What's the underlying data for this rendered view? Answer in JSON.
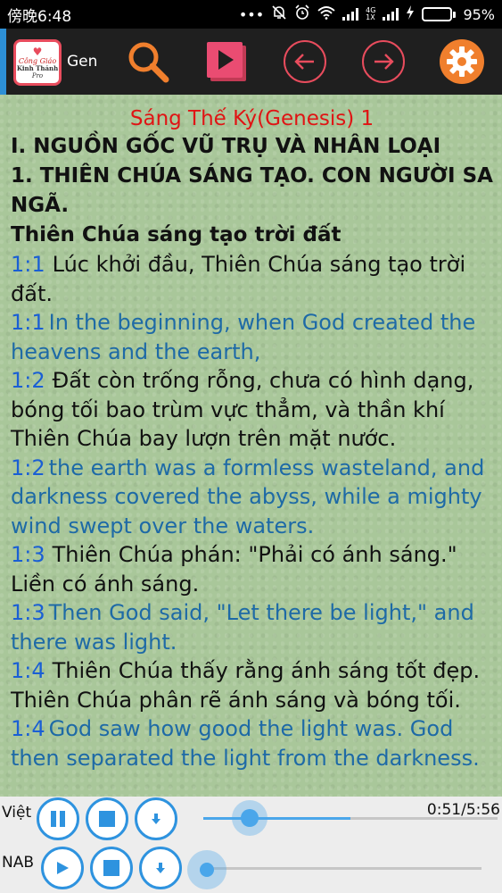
{
  "status_bar": {
    "time": "傍晚6:48",
    "dots": "•••",
    "network_4g": "4G",
    "network_1x": "1X",
    "battery_pct": "95%",
    "battery_level": 0.95
  },
  "toolbar": {
    "logo_lines": [
      "Công Giáo",
      "Kinh Thánh",
      "Pro"
    ],
    "book_label": "Gen",
    "colors": {
      "bar": "#1f1f1f",
      "accent": "#2d8fd5",
      "pink": "#e84c5d",
      "orange": "#f07f2d"
    }
  },
  "reader": {
    "chapter_title": "Sáng Thế Ký(Genesis) 1",
    "headings": [
      "I. NGUỒN GỐC VŨ TRỤ VÀ NHÂN LOẠI",
      "1. THIÊN CHÚA SÁNG TẠO. CON NGƯỜI SA NGÃ.",
      "Thiên Chúa sáng tạo trời đất"
    ],
    "verses": [
      {
        "ref": "1:1",
        "lang": "vi",
        "text": "Lúc khởi đầu, Thiên Chúa sáng tạo trời đất."
      },
      {
        "ref": "1:1",
        "lang": "en",
        "text": "In the beginning, when God created the heavens and the earth,"
      },
      {
        "ref": "1:2",
        "lang": "vi",
        "text": "Đất còn trống rỗng, chưa có hình dạng, bóng tối bao trùm vực thẳm, và thần khí Thiên Chúa bay lượn trên mặt nước."
      },
      {
        "ref": "1:2",
        "lang": "en",
        "text": "the earth was a formless wasteland, and darkness covered the abyss, while a mighty wind swept over the waters."
      },
      {
        "ref": "1:3",
        "lang": "vi",
        "text": "Thiên Chúa phán: \"Phải có ánh sáng.\" Liền có ánh sáng."
      },
      {
        "ref": "1:3",
        "lang": "en",
        "text": "Then God said, \"Let there be light,\" and there was light."
      },
      {
        "ref": "1:4",
        "lang": "vi",
        "text": "Thiên Chúa thấy rằng ánh sáng tốt đẹp. Thiên Chúa phân rẽ ánh sáng và bóng tối."
      },
      {
        "ref": "1:4",
        "lang": "en",
        "text": "God saw how good the light was. God then separated the light from the darkness."
      }
    ]
  },
  "player": {
    "viet": {
      "label": "Việt",
      "time": "0:51/5:56",
      "progress": 0.15,
      "buffered": 0.5
    },
    "nab": {
      "label": "NAB",
      "progress": 0.0
    }
  }
}
